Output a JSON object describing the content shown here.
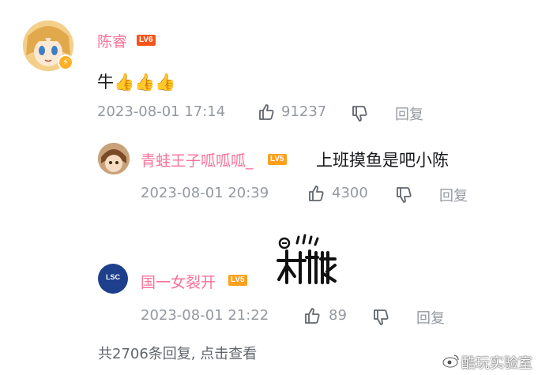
{
  "comments": {
    "main": {
      "username": "陈睿",
      "level": "LV6",
      "text": "牛👍👍👍",
      "timestamp": "2023-08-01 17:14",
      "likes": "91237",
      "reply_label": "回复"
    },
    "replies": [
      {
        "username": "青蛙王子呱呱呱_",
        "level": "LV5",
        "text": "上班摸鱼是吧小陈",
        "timestamp": "2023-08-01 20:39",
        "likes": "4300",
        "reply_label": "回复"
      },
      {
        "username": "国一女裂开",
        "level": "LV5",
        "text": "",
        "avatar_text": "LSC",
        "timestamp": "2023-08-01 21:22",
        "likes": "89",
        "reply_label": "回复"
      }
    ],
    "view_more": "共2706条回复, 点击查看"
  },
  "watermark": "酷玩实验室",
  "colors": {
    "username": "#fb7299",
    "lv6": "#f6541b",
    "lv5": "#ff9f1c",
    "meta": "#9499a0"
  },
  "icons": [
    "thumbs-up-icon",
    "thumbs-down-icon",
    "lightning-icon"
  ]
}
